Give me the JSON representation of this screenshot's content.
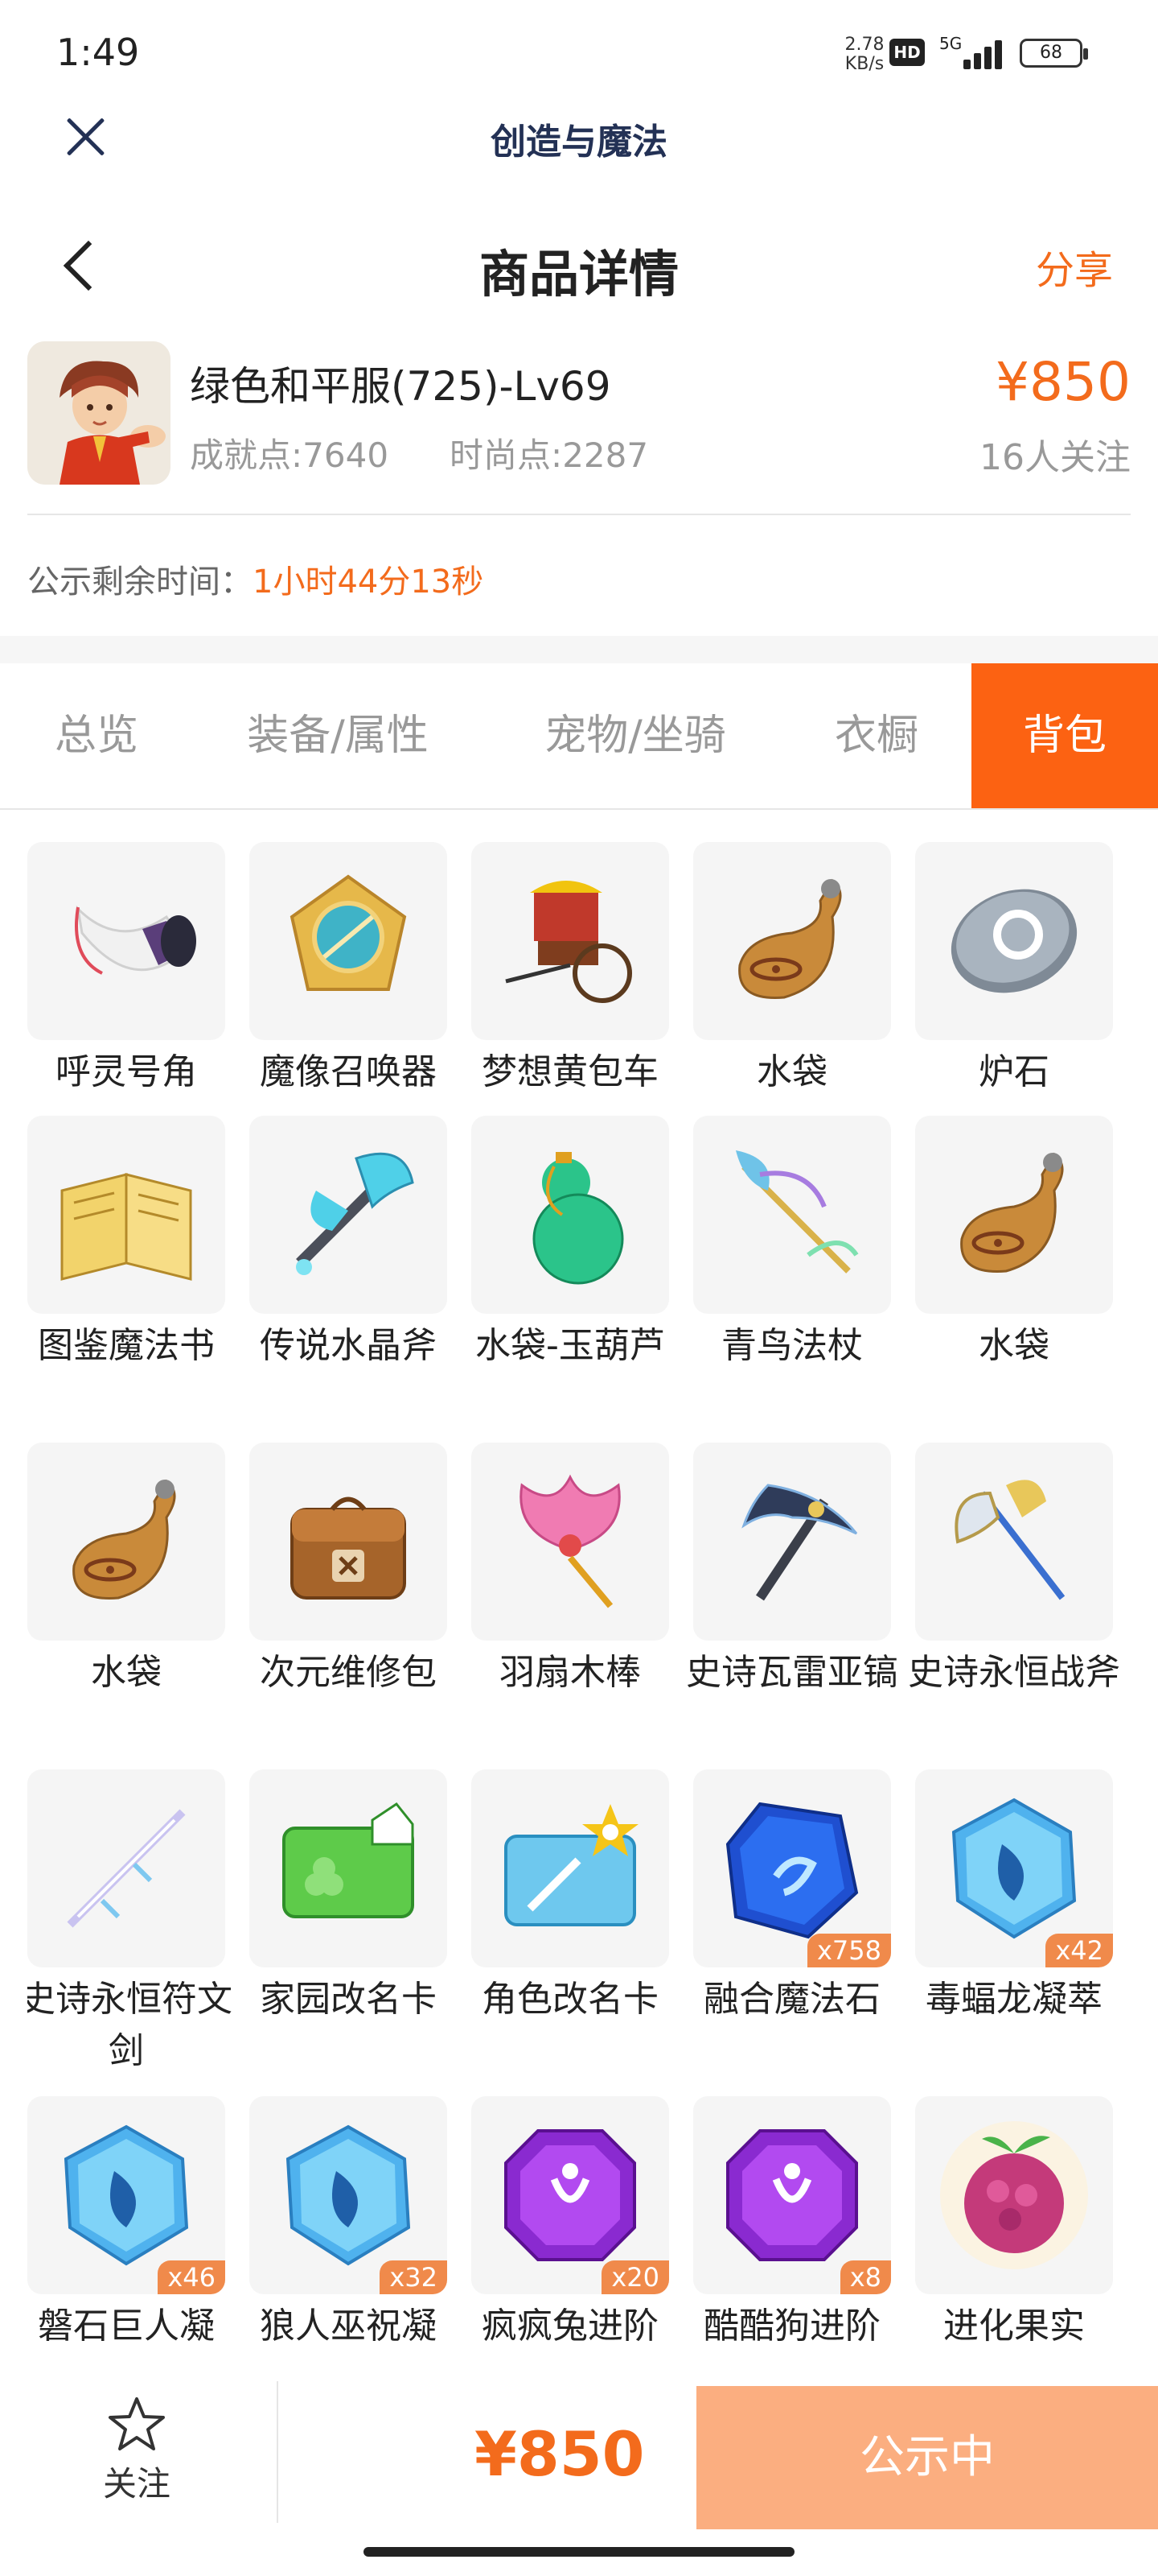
{
  "status_bar": {
    "time": "1:49",
    "net_speed": "2.78",
    "net_unit": "KB/s",
    "hd": "HD",
    "network": "5G",
    "battery": "68"
  },
  "app_bar": {
    "title": "创造与魔法"
  },
  "header": {
    "title": "商品详情",
    "share": "分享"
  },
  "product": {
    "name": "绿色和平服(725)-Lv69",
    "achievement": "成就点:7640",
    "fashion": "时尚点:2287",
    "price": "¥850",
    "followers": "16人关注",
    "notice_label": "公示剩余时间：",
    "countdown": "1小时44分13秒"
  },
  "tabs": [
    {
      "label": "总览",
      "active": false
    },
    {
      "label": "装备/属性",
      "active": false
    },
    {
      "label": "宠物/坐骑",
      "active": false
    },
    {
      "label": "衣橱",
      "active": false
    },
    {
      "label": "背包",
      "active": true
    }
  ],
  "inventory": [
    {
      "name": "呼灵号角",
      "icon": "horn-icon",
      "qty": ""
    },
    {
      "name": "魔像召唤器",
      "icon": "golem-summoner-icon",
      "qty": ""
    },
    {
      "name": "梦想黄包车",
      "icon": "rickshaw-icon",
      "qty": ""
    },
    {
      "name": "水袋",
      "icon": "water-bag-icon",
      "qty": ""
    },
    {
      "name": "炉石",
      "icon": "hearthstone-icon",
      "qty": ""
    },
    {
      "name": "图鉴魔法书",
      "icon": "spellbook-icon",
      "qty": ""
    },
    {
      "name": "传说水晶斧",
      "icon": "crystal-axe-icon",
      "qty": ""
    },
    {
      "name": "水袋-玉葫芦",
      "icon": "jade-gourd-icon",
      "qty": ""
    },
    {
      "name": "青鸟法杖",
      "icon": "bluebird-staff-icon",
      "qty": ""
    },
    {
      "name": "水袋",
      "icon": "water-bag-icon",
      "qty": ""
    },
    {
      "name": "水袋",
      "icon": "water-bag-icon",
      "qty": ""
    },
    {
      "name": "次元维修包",
      "icon": "repair-kit-icon",
      "qty": ""
    },
    {
      "name": "羽扇木棒",
      "icon": "feather-fan-icon",
      "qty": ""
    },
    {
      "name": "史诗瓦雷亚镐",
      "icon": "pickaxe-icon",
      "qty": ""
    },
    {
      "name": "史诗永恒战斧",
      "icon": "battle-axe-icon",
      "qty": ""
    },
    {
      "name": "史诗永恒符文剑",
      "icon": "rune-sword-icon",
      "qty": ""
    },
    {
      "name": "家园改名卡",
      "icon": "home-rename-card-icon",
      "qty": ""
    },
    {
      "name": "角色改名卡",
      "icon": "character-rename-card-icon",
      "qty": ""
    },
    {
      "name": "融合魔法石",
      "icon": "fusion-stone-icon",
      "qty": "x758"
    },
    {
      "name": "毒蝠龙凝萃",
      "icon": "essence-crystal-icon",
      "qty": "x42"
    },
    {
      "name": "磐石巨人凝",
      "icon": "essence-crystal-icon",
      "qty": "x46"
    },
    {
      "name": "狼人巫祝凝",
      "icon": "essence-crystal-icon",
      "qty": "x32"
    },
    {
      "name": "疯疯兔进阶",
      "icon": "purple-gem-icon",
      "qty": "x20"
    },
    {
      "name": "酷酷狗进阶",
      "icon": "purple-gem-icon",
      "qty": "x8"
    },
    {
      "name": "进化果实",
      "icon": "evolution-fruit-icon",
      "qty": ""
    }
  ],
  "bottom_bar": {
    "follow_label": "关注",
    "price": "¥850",
    "status_button": "公示中"
  },
  "colors": {
    "accent": "#f36b1c",
    "tab_active": "#fc6212",
    "status_button": "#fbae80"
  }
}
